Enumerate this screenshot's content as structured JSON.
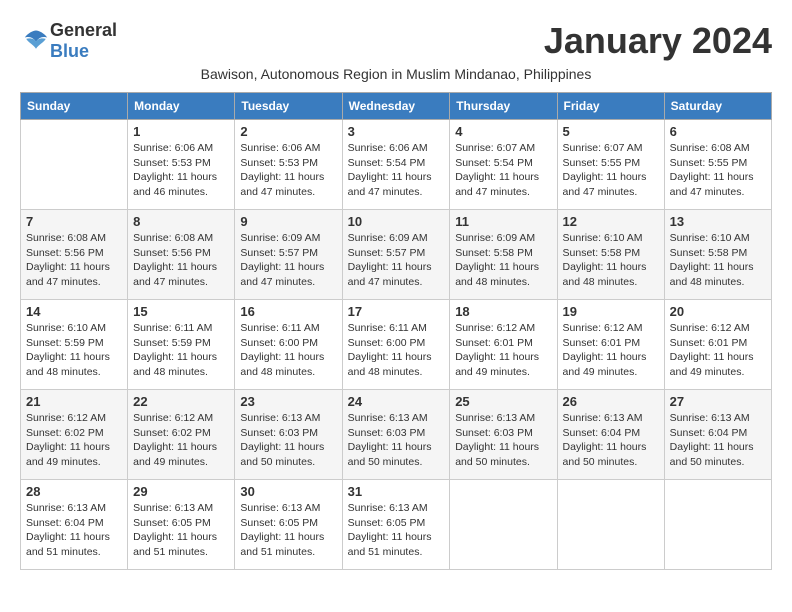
{
  "header": {
    "logo_general": "General",
    "logo_blue": "Blue",
    "month_title": "January 2024",
    "subtitle": "Bawison, Autonomous Region in Muslim Mindanao, Philippines"
  },
  "days_of_week": [
    "Sunday",
    "Monday",
    "Tuesday",
    "Wednesday",
    "Thursday",
    "Friday",
    "Saturday"
  ],
  "weeks": [
    [
      {
        "day": "",
        "info": ""
      },
      {
        "day": "1",
        "info": "Sunrise: 6:06 AM\nSunset: 5:53 PM\nDaylight: 11 hours\nand 46 minutes."
      },
      {
        "day": "2",
        "info": "Sunrise: 6:06 AM\nSunset: 5:53 PM\nDaylight: 11 hours\nand 47 minutes."
      },
      {
        "day": "3",
        "info": "Sunrise: 6:06 AM\nSunset: 5:54 PM\nDaylight: 11 hours\nand 47 minutes."
      },
      {
        "day": "4",
        "info": "Sunrise: 6:07 AM\nSunset: 5:54 PM\nDaylight: 11 hours\nand 47 minutes."
      },
      {
        "day": "5",
        "info": "Sunrise: 6:07 AM\nSunset: 5:55 PM\nDaylight: 11 hours\nand 47 minutes."
      },
      {
        "day": "6",
        "info": "Sunrise: 6:08 AM\nSunset: 5:55 PM\nDaylight: 11 hours\nand 47 minutes."
      }
    ],
    [
      {
        "day": "7",
        "info": "Sunrise: 6:08 AM\nSunset: 5:56 PM\nDaylight: 11 hours\nand 47 minutes."
      },
      {
        "day": "8",
        "info": "Sunrise: 6:08 AM\nSunset: 5:56 PM\nDaylight: 11 hours\nand 47 minutes."
      },
      {
        "day": "9",
        "info": "Sunrise: 6:09 AM\nSunset: 5:57 PM\nDaylight: 11 hours\nand 47 minutes."
      },
      {
        "day": "10",
        "info": "Sunrise: 6:09 AM\nSunset: 5:57 PM\nDaylight: 11 hours\nand 47 minutes."
      },
      {
        "day": "11",
        "info": "Sunrise: 6:09 AM\nSunset: 5:58 PM\nDaylight: 11 hours\nand 48 minutes."
      },
      {
        "day": "12",
        "info": "Sunrise: 6:10 AM\nSunset: 5:58 PM\nDaylight: 11 hours\nand 48 minutes."
      },
      {
        "day": "13",
        "info": "Sunrise: 6:10 AM\nSunset: 5:58 PM\nDaylight: 11 hours\nand 48 minutes."
      }
    ],
    [
      {
        "day": "14",
        "info": "Sunrise: 6:10 AM\nSunset: 5:59 PM\nDaylight: 11 hours\nand 48 minutes."
      },
      {
        "day": "15",
        "info": "Sunrise: 6:11 AM\nSunset: 5:59 PM\nDaylight: 11 hours\nand 48 minutes."
      },
      {
        "day": "16",
        "info": "Sunrise: 6:11 AM\nSunset: 6:00 PM\nDaylight: 11 hours\nand 48 minutes."
      },
      {
        "day": "17",
        "info": "Sunrise: 6:11 AM\nSunset: 6:00 PM\nDaylight: 11 hours\nand 48 minutes."
      },
      {
        "day": "18",
        "info": "Sunrise: 6:12 AM\nSunset: 6:01 PM\nDaylight: 11 hours\nand 49 minutes."
      },
      {
        "day": "19",
        "info": "Sunrise: 6:12 AM\nSunset: 6:01 PM\nDaylight: 11 hours\nand 49 minutes."
      },
      {
        "day": "20",
        "info": "Sunrise: 6:12 AM\nSunset: 6:01 PM\nDaylight: 11 hours\nand 49 minutes."
      }
    ],
    [
      {
        "day": "21",
        "info": "Sunrise: 6:12 AM\nSunset: 6:02 PM\nDaylight: 11 hours\nand 49 minutes."
      },
      {
        "day": "22",
        "info": "Sunrise: 6:12 AM\nSunset: 6:02 PM\nDaylight: 11 hours\nand 49 minutes."
      },
      {
        "day": "23",
        "info": "Sunrise: 6:13 AM\nSunset: 6:03 PM\nDaylight: 11 hours\nand 50 minutes."
      },
      {
        "day": "24",
        "info": "Sunrise: 6:13 AM\nSunset: 6:03 PM\nDaylight: 11 hours\nand 50 minutes."
      },
      {
        "day": "25",
        "info": "Sunrise: 6:13 AM\nSunset: 6:03 PM\nDaylight: 11 hours\nand 50 minutes."
      },
      {
        "day": "26",
        "info": "Sunrise: 6:13 AM\nSunset: 6:04 PM\nDaylight: 11 hours\nand 50 minutes."
      },
      {
        "day": "27",
        "info": "Sunrise: 6:13 AM\nSunset: 6:04 PM\nDaylight: 11 hours\nand 50 minutes."
      }
    ],
    [
      {
        "day": "28",
        "info": "Sunrise: 6:13 AM\nSunset: 6:04 PM\nDaylight: 11 hours\nand 51 minutes."
      },
      {
        "day": "29",
        "info": "Sunrise: 6:13 AM\nSunset: 6:05 PM\nDaylight: 11 hours\nand 51 minutes."
      },
      {
        "day": "30",
        "info": "Sunrise: 6:13 AM\nSunset: 6:05 PM\nDaylight: 11 hours\nand 51 minutes."
      },
      {
        "day": "31",
        "info": "Sunrise: 6:13 AM\nSunset: 6:05 PM\nDaylight: 11 hours\nand 51 minutes."
      },
      {
        "day": "",
        "info": ""
      },
      {
        "day": "",
        "info": ""
      },
      {
        "day": "",
        "info": ""
      }
    ]
  ]
}
